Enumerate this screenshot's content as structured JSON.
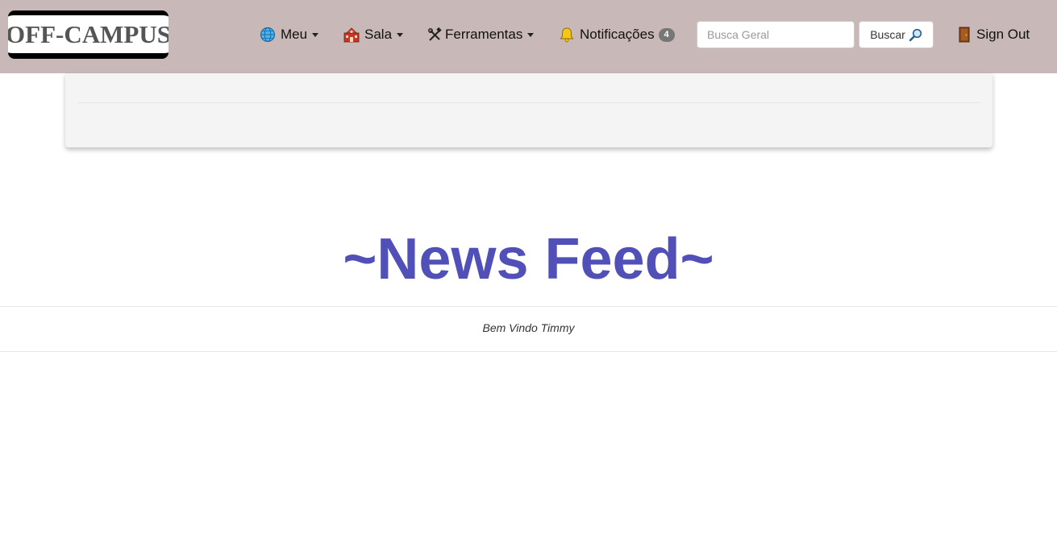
{
  "navbar": {
    "logo_text": "OFF-CAMPUS",
    "menu": {
      "label": "Meu",
      "icon": "globe-icon"
    },
    "sala": {
      "label": "Sala",
      "icon": "school-icon"
    },
    "ferramentas": {
      "label": "Ferramentas",
      "icon": "tools-icon"
    },
    "notificacoes": {
      "label": "Notificações",
      "icon": "bell-icon",
      "count": "4"
    },
    "search": {
      "placeholder": "Busca Geral",
      "value": "",
      "button_label": "Buscar",
      "button_icon": "magnifier-icon"
    },
    "sign_out": {
      "label": "Sign Out",
      "icon": "door-icon"
    }
  },
  "feed": {
    "title": "~News Feed~",
    "welcome": "Bem Vindo Timmy"
  },
  "colors": {
    "navbar_bg": "#c8b8b7",
    "title": "#5150b8",
    "panel_bg": "#f4f4f4"
  }
}
